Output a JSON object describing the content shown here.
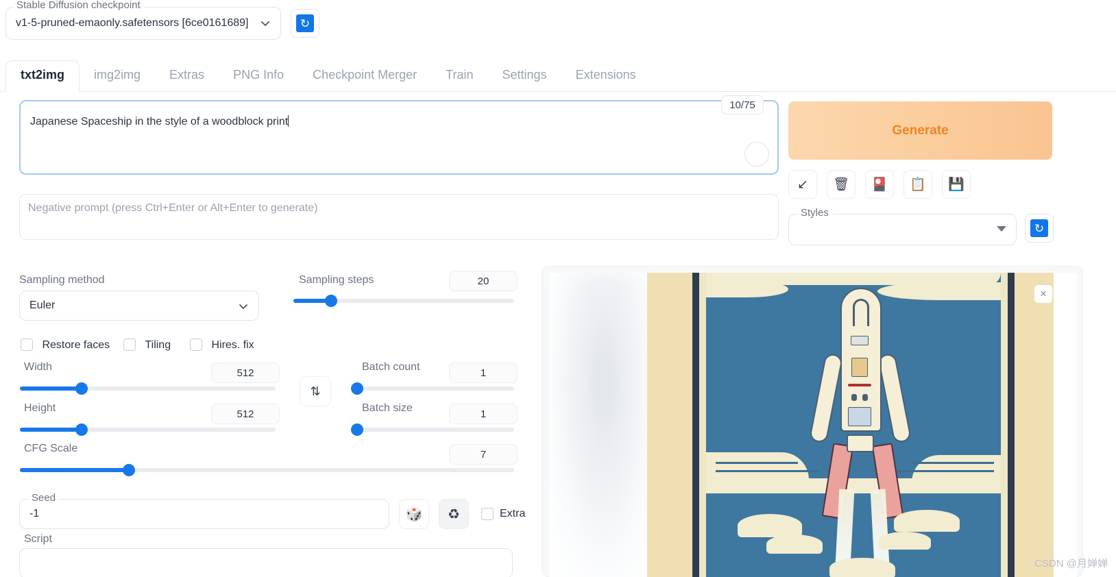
{
  "checkpoint": {
    "label": "Stable Diffusion checkpoint",
    "value": "v1-5-pruned-emaonly.safetensors [6ce0161689]",
    "refresh_icon": "refresh-icon"
  },
  "tabs": [
    {
      "label": "txt2img",
      "active": true
    },
    {
      "label": "img2img",
      "active": false
    },
    {
      "label": "Extras",
      "active": false
    },
    {
      "label": "PNG Info",
      "active": false
    },
    {
      "label": "Checkpoint Merger",
      "active": false
    },
    {
      "label": "Train",
      "active": false
    },
    {
      "label": "Settings",
      "active": false
    },
    {
      "label": "Extensions",
      "active": false
    }
  ],
  "prompt": {
    "value": "Japanese Spaceship in the style of a woodblock print",
    "token_counter": "10/75"
  },
  "negative_prompt": {
    "placeholder": "Negative prompt (press Ctrl+Enter or Alt+Enter to generate)",
    "value": ""
  },
  "generate": {
    "label": "Generate",
    "accent": "#ef8524",
    "background": "#fbcc9b"
  },
  "tool_icons": [
    {
      "name": "restore-progress-icon",
      "glyph": "↙"
    },
    {
      "name": "clear-prompt-trash-icon",
      "glyph": "🗑"
    },
    {
      "name": "apply-style-icon",
      "glyph": "🎴"
    },
    {
      "name": "paste-clipboard-icon",
      "glyph": "📋"
    },
    {
      "name": "save-style-floppy-icon",
      "glyph": "💾"
    }
  ],
  "styles": {
    "label": "Styles",
    "value": "",
    "refresh_icon": "refresh-icon"
  },
  "sampling": {
    "method_label": "Sampling method",
    "method_value": "Euler",
    "steps_label": "Sampling steps",
    "steps_value": "20",
    "steps_percent": 17
  },
  "checkboxes": [
    {
      "label": "Restore faces",
      "checked": false
    },
    {
      "label": "Tiling",
      "checked": false
    },
    {
      "label": "Hires. fix",
      "checked": false
    }
  ],
  "dimensions": {
    "width_label": "Width",
    "width_value": "512",
    "width_percent": 24,
    "height_label": "Height",
    "height_value": "512",
    "height_percent": 24,
    "swap_icon": "swap-vertical-icon"
  },
  "batch": {
    "count_label": "Batch count",
    "count_value": "1",
    "count_percent": 0,
    "size_label": "Batch size",
    "size_value": "1",
    "size_percent": 0
  },
  "cfg": {
    "label": "CFG Scale",
    "value": "7",
    "percent": 22
  },
  "seed": {
    "label": "Seed",
    "value": "-1",
    "dice_icon": "🎲",
    "recycle_icon": "♻",
    "extra_label": "Extra",
    "extra_checked": false
  },
  "script": {
    "label": "Script",
    "value": ""
  },
  "result_panel": {
    "close_label": "×",
    "image_alt": "Japanese woodblock print style spaceship launching",
    "colors": {
      "paper": "#f1dfb4",
      "border_dark": "#2f3b4f",
      "sky_blue": "#3e78a0",
      "cream": "#f2ecd0",
      "rocket_body": "#f4efd6",
      "booster_pink": "#eaa39c"
    }
  },
  "watermark": "CSDN @月婵婵"
}
